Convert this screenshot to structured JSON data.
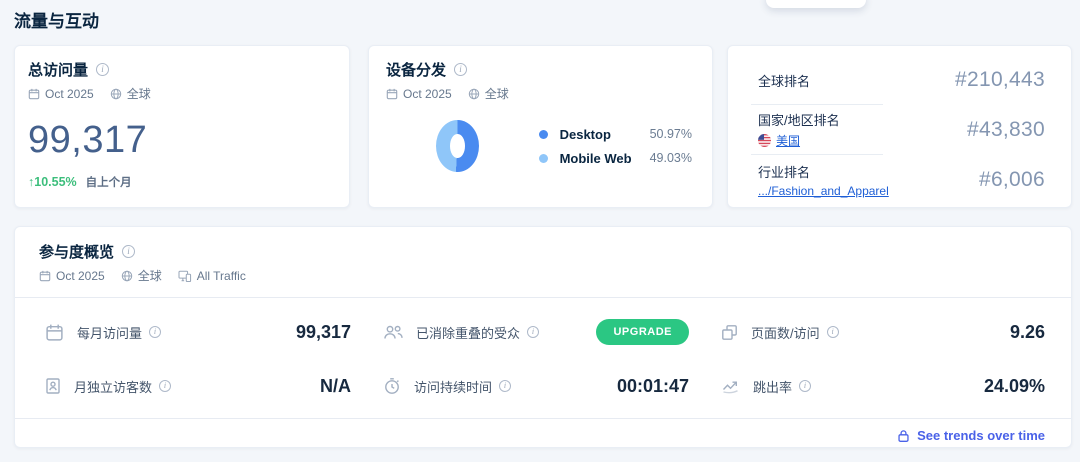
{
  "page": {
    "title": "流量与互动"
  },
  "visits_card": {
    "title": "总访问量",
    "period": "Oct 2025",
    "region": "全球",
    "value": "99,317",
    "change_arrow": "↑",
    "change": "10.55%",
    "change_label": "自上个月"
  },
  "devices_card": {
    "title": "设备分发",
    "period": "Oct 2025",
    "region": "全球",
    "legend": [
      {
        "label": "Desktop",
        "value": "50.97%"
      },
      {
        "label": "Mobile Web",
        "value": "49.03%"
      }
    ]
  },
  "ranks_card": {
    "rows": [
      {
        "label": "全球排名",
        "value": "#210,443"
      },
      {
        "label": "国家/地区排名",
        "link": "美国",
        "value": "#43,830"
      },
      {
        "label": "行业排名",
        "link": ".../Fashion_and_Apparel",
        "value": "#6,006"
      }
    ]
  },
  "engagement_card": {
    "title": "参与度概览",
    "period": "Oct 2025",
    "region": "全球",
    "traffic_filter": "All Traffic",
    "metrics": [
      {
        "label": "每月访问量",
        "value": "99,317"
      },
      {
        "label": "已消除重叠的受众",
        "value": "UPGRADE"
      },
      {
        "label": "页面数/访问",
        "value": "9.26"
      },
      {
        "label": "月独立访客数",
        "value": "N/A"
      },
      {
        "label": "访问持续时间",
        "value": "00:01:47"
      },
      {
        "label": "跳出率",
        "value": "24.09%"
      }
    ],
    "footer_link": "See trends over time"
  },
  "chart_data": {
    "type": "pie",
    "title": "设备分发",
    "categories": [
      "Desktop",
      "Mobile Web"
    ],
    "values": [
      50.97,
      49.03
    ],
    "colors": [
      "#4A8BF0",
      "#8FC6F9"
    ],
    "donut": true,
    "legend_position": "right"
  },
  "colors": {
    "accent_green": "#2BC783",
    "positive_green": "#3DBE7C",
    "link_blue": "#1F5FD6",
    "trends_blue": "#4A62E8"
  }
}
